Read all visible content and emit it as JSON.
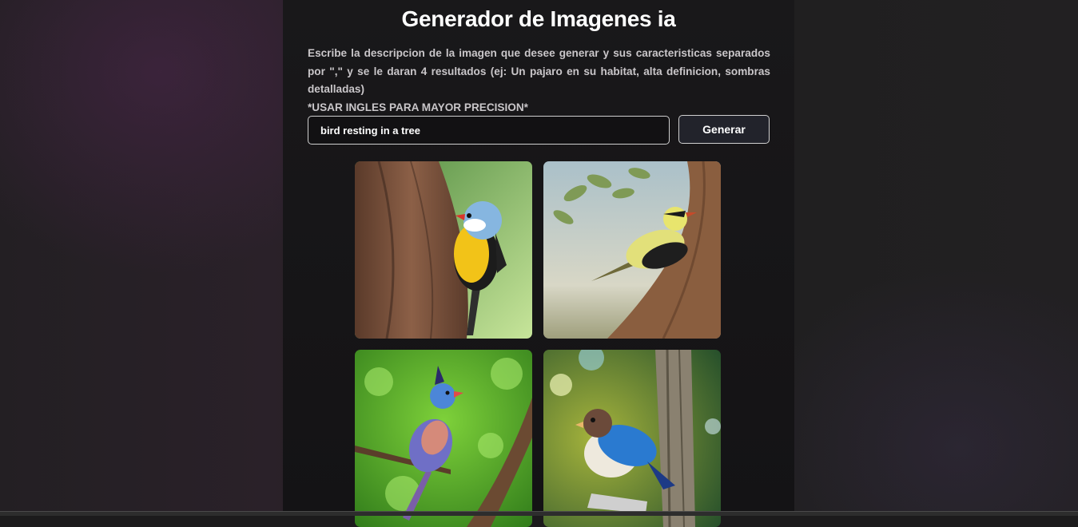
{
  "header": {
    "title": "Generador de Imagenes ia"
  },
  "instructions": {
    "text": "Escribe la descripcion de la imagen que desee generar y sus caracteristicas separados por \",\" y se le daran 4 resultados (ej: Un pajaro en su habitat, alta definicion, sombras detalladas)",
    "note": "*USAR INGLES PARA MAYOR PRECISION*"
  },
  "prompt": {
    "value": "bird resting in a tree"
  },
  "actions": {
    "generate_label": "Generar"
  },
  "results": [
    {
      "name": "result-image-1",
      "icon": "bird-image-yellow-blue"
    },
    {
      "name": "result-image-2",
      "icon": "bird-image-yellow-painting"
    },
    {
      "name": "result-image-3",
      "icon": "bird-image-crested-purple"
    },
    {
      "name": "result-image-4",
      "icon": "bird-image-blue-white"
    }
  ],
  "colors": {
    "panel": "#161517",
    "text_primary": "#ffffff",
    "text_secondary": "#c9c6c9",
    "button_bg": "#22232b",
    "border": "#cfcfcf"
  }
}
